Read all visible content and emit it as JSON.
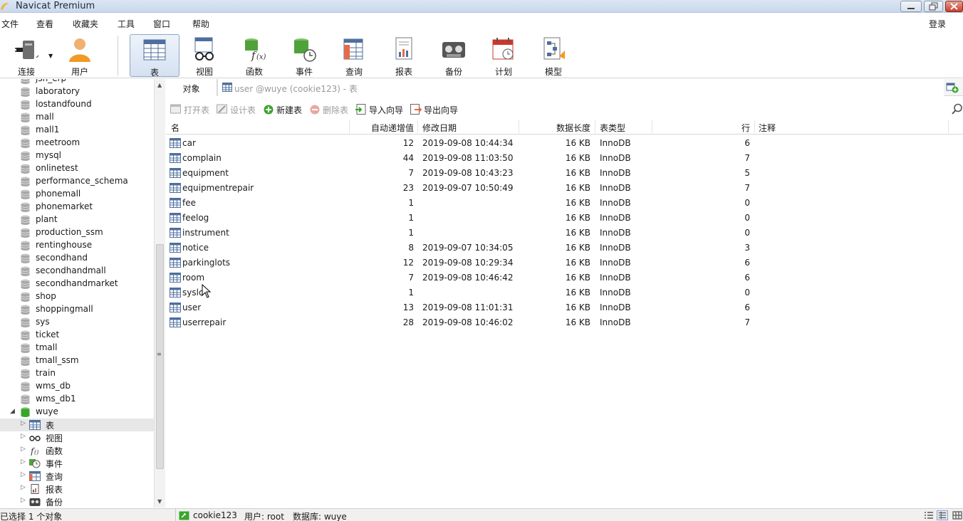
{
  "window": {
    "title": "Navicat Premium"
  },
  "menu": {
    "items": [
      "文件",
      "查看",
      "收藏夹",
      "工具",
      "窗口",
      "帮助"
    ],
    "login": "登录"
  },
  "toolbar": {
    "buttons": [
      {
        "label": "连接",
        "icon": "plug-icon"
      },
      {
        "label": "用户",
        "icon": "user-icon"
      },
      {
        "label": "表",
        "icon": "table-icon"
      },
      {
        "label": "视图",
        "icon": "glasses-icon"
      },
      {
        "label": "函数",
        "icon": "function-icon"
      },
      {
        "label": "事件",
        "icon": "event-clock-icon"
      },
      {
        "label": "查询",
        "icon": "query-icon"
      },
      {
        "label": "报表",
        "icon": "report-icon"
      },
      {
        "label": "备份",
        "icon": "tape-icon"
      },
      {
        "label": "计划",
        "icon": "calendar-icon"
      },
      {
        "label": "模型",
        "icon": "model-icon"
      }
    ]
  },
  "sidebar": {
    "databases": [
      "jsh_erp",
      "laboratory",
      "lostandfound",
      "mall",
      "mall1",
      "meetroom",
      "mysql",
      "onlinetest",
      "performance_schema",
      "phonemall",
      "phonemarket",
      "plant",
      "production_ssm",
      "rentinghouse",
      "secondhand",
      "secondhandmall",
      "secondhandmarket",
      "shop",
      "shoppingmall",
      "sys",
      "ticket",
      "tmall",
      "tmall_ssm",
      "train",
      "wms_db",
      "wms_db1"
    ],
    "open_db": "wuye",
    "sub_items": [
      "表",
      "视图",
      "函数",
      "事件",
      "查询",
      "报表",
      "备份"
    ]
  },
  "tabs": {
    "objects": "对象",
    "current": "user @wuye (cookie123) - 表"
  },
  "object_toolbar": {
    "open": "打开表",
    "design": "设计表",
    "new": "新建表",
    "delete": "删除表",
    "import": "导入向导",
    "export": "导出向导"
  },
  "grid": {
    "headers": {
      "name": "名",
      "auto_inc": "自动递增值",
      "modified": "修改日期",
      "data_length": "数据长度",
      "table_type": "表类型",
      "rows": "行",
      "comment": "注释"
    },
    "rows": [
      {
        "name": "car",
        "auto_inc": "12",
        "modified": "2019-09-08 10:44:34",
        "data_length": "16 KB",
        "table_type": "InnoDB",
        "rows": "6"
      },
      {
        "name": "complain",
        "auto_inc": "44",
        "modified": "2019-09-08 11:03:50",
        "data_length": "16 KB",
        "table_type": "InnoDB",
        "rows": "7"
      },
      {
        "name": "equipment",
        "auto_inc": "7",
        "modified": "2019-09-08 10:43:23",
        "data_length": "16 KB",
        "table_type": "InnoDB",
        "rows": "5"
      },
      {
        "name": "equipmentrepair",
        "auto_inc": "23",
        "modified": "2019-09-07 10:50:49",
        "data_length": "16 KB",
        "table_type": "InnoDB",
        "rows": "7"
      },
      {
        "name": "fee",
        "auto_inc": "1",
        "modified": "",
        "data_length": "16 KB",
        "table_type": "InnoDB",
        "rows": "0"
      },
      {
        "name": "feelog",
        "auto_inc": "1",
        "modified": "",
        "data_length": "16 KB",
        "table_type": "InnoDB",
        "rows": "0"
      },
      {
        "name": "instrument",
        "auto_inc": "1",
        "modified": "",
        "data_length": "16 KB",
        "table_type": "InnoDB",
        "rows": "0"
      },
      {
        "name": "notice",
        "auto_inc": "8",
        "modified": "2019-09-07 10:34:05",
        "data_length": "16 KB",
        "table_type": "InnoDB",
        "rows": "3"
      },
      {
        "name": "parkinglots",
        "auto_inc": "12",
        "modified": "2019-09-08 10:29:34",
        "data_length": "16 KB",
        "table_type": "InnoDB",
        "rows": "6"
      },
      {
        "name": "room",
        "auto_inc": "7",
        "modified": "2019-09-08 10:46:42",
        "data_length": "16 KB",
        "table_type": "InnoDB",
        "rows": "6"
      },
      {
        "name": "syslo",
        "auto_inc": "1",
        "modified": "",
        "data_length": "16 KB",
        "table_type": "InnoDB",
        "rows": "0"
      },
      {
        "name": "user",
        "auto_inc": "13",
        "modified": "2019-09-08 11:01:31",
        "data_length": "16 KB",
        "table_type": "InnoDB",
        "rows": "6"
      },
      {
        "name": "userrepair",
        "auto_inc": "28",
        "modified": "2019-09-08 10:46:02",
        "data_length": "16 KB",
        "table_type": "InnoDB",
        "rows": "7"
      }
    ]
  },
  "status": {
    "selection": "已选择 1 个对象",
    "connection": "cookie123",
    "user": "用户: root",
    "database": "数据库: wuye"
  },
  "colors": {
    "toolbar_selected": "#d5e1f1",
    "db_icon": "#9a9a9a",
    "open_db_icon": "#3aa52b",
    "table_icon": "#4e6f9e"
  }
}
